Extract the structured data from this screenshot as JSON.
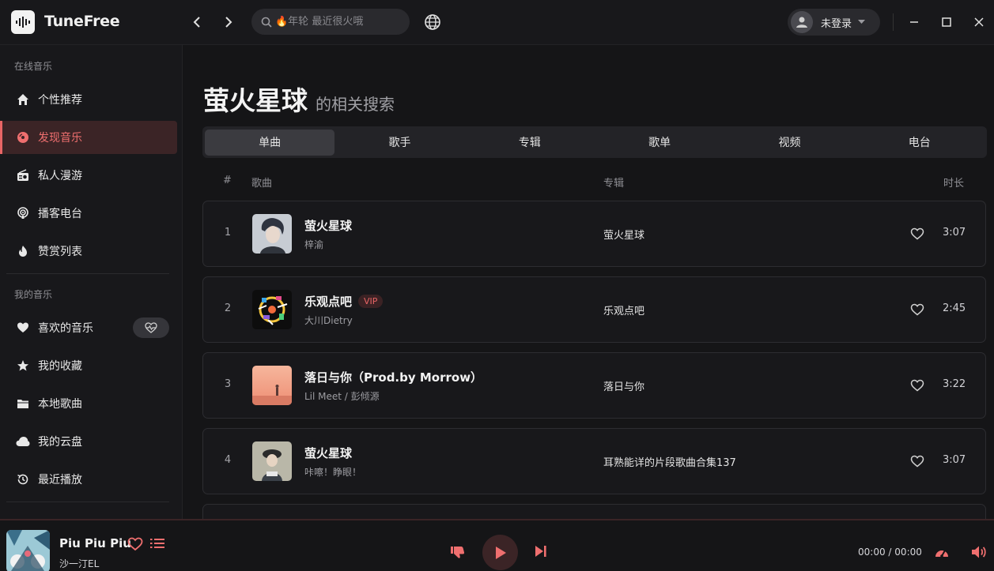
{
  "app": {
    "name": "TuneFree"
  },
  "header": {
    "search_placeholder": "🔥年轮 最近很火哦",
    "user_name": "未登录"
  },
  "sidebar": {
    "section_online": "在线音乐",
    "online_items": [
      {
        "label": "个性推荐",
        "icon": "home-icon"
      },
      {
        "label": "发现音乐",
        "icon": "disc-icon",
        "active": true
      },
      {
        "label": "私人漫游",
        "icon": "radio-icon"
      },
      {
        "label": "播客电台",
        "icon": "podcast-icon"
      },
      {
        "label": "赞赏列表",
        "icon": "fire-icon"
      }
    ],
    "section_mine": "我的音乐",
    "my_items": [
      {
        "label": "喜欢的音乐",
        "icon": "heart-icon"
      },
      {
        "label": "我的收藏",
        "icon": "star-icon"
      },
      {
        "label": "本地歌曲",
        "icon": "folder-icon"
      },
      {
        "label": "我的云盘",
        "icon": "cloud-icon"
      },
      {
        "label": "最近播放",
        "icon": "history-icon"
      }
    ]
  },
  "main": {
    "keyword": "萤火星球",
    "subtitle": "的相关搜索",
    "tabs": [
      "单曲",
      "歌手",
      "专辑",
      "歌单",
      "视频",
      "电台"
    ],
    "active_tab": 0,
    "columns": {
      "index": "#",
      "song": "歌曲",
      "album": "专辑",
      "duration": "时长"
    },
    "songs": [
      {
        "index": "1",
        "title": "萤火星球",
        "artist": "梓渝",
        "album": "萤火星球",
        "duration": "3:07",
        "vip": ""
      },
      {
        "index": "2",
        "title": "乐观点吧",
        "artist": "大川Dietry",
        "album": "乐观点吧",
        "duration": "2:45",
        "vip": "VIP"
      },
      {
        "index": "3",
        "title": "落日与你（Prod.by Morrow）",
        "artist": "Lil Meet / 彭倾源",
        "album": "落日与你",
        "duration": "3:22",
        "vip": ""
      },
      {
        "index": "4",
        "title": "萤火星球",
        "artist": "咔嚓！睁眼！",
        "album": "耳熟能详的片段歌曲合集137",
        "duration": "3:07",
        "vip": ""
      }
    ]
  },
  "player": {
    "title": "Piu Piu Piu",
    "artist": "沙一汀EL",
    "current_time": "00:00",
    "separator": "/",
    "total_time": "00:00"
  },
  "colors": {
    "accent": "#e96565",
    "background": "#151517",
    "surface": "#18181b"
  }
}
